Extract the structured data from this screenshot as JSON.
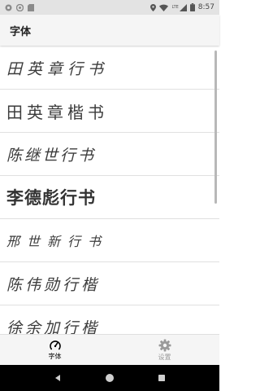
{
  "status_bar": {
    "time": "8:57",
    "network": "LTE",
    "icons": [
      "photo-icon",
      "sync-icon",
      "sd-card-icon",
      "location-icon",
      "wifi-icon",
      "signal-icon",
      "battery-icon"
    ]
  },
  "app_bar": {
    "title": "字体"
  },
  "font_list": {
    "items": [
      {
        "label": "田英章行书"
      },
      {
        "label": "田英章楷书"
      },
      {
        "label": "陈继世行书"
      },
      {
        "label": "李德彪行书"
      },
      {
        "label": "邢世新行书"
      },
      {
        "label": "陈伟勋行楷"
      },
      {
        "label": "徐余加行楷"
      }
    ]
  },
  "bottom_nav": {
    "items": [
      {
        "label": "字体",
        "icon": "speedometer-icon",
        "active": true
      },
      {
        "label": "设置",
        "icon": "gear-icon",
        "active": false
      }
    ]
  },
  "system_nav": {
    "icons": [
      "back-icon",
      "home-icon",
      "recents-icon"
    ]
  },
  "colors": {
    "active": "#000000",
    "inactive": "#9a9a9a",
    "text": "#3c3c3c"
  }
}
